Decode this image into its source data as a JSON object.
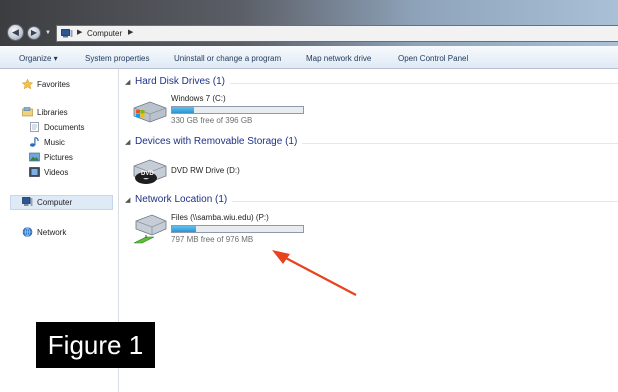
{
  "address_bar": {
    "path": "Computer",
    "icon": "computer-icon"
  },
  "command_bar": {
    "organize": "Organize ▾",
    "system_properties": "System properties",
    "uninstall": "Uninstall or change a program",
    "map_network_drive": "Map network drive",
    "open_control_panel": "Open Control Panel"
  },
  "nav_pane": {
    "favorites": "Favorites",
    "libraries": "Libraries",
    "documents": "Documents",
    "music": "Music",
    "pictures": "Pictures",
    "videos": "Videos",
    "computer": "Computer",
    "network": "Network"
  },
  "groups": {
    "hard_disk": {
      "title": "Hard Disk Drives (1)",
      "drive": {
        "name": "Windows 7 (C:)",
        "free_text": "330 GB free of 396 GB",
        "used_fraction": 0.167,
        "icon": "windows-drive-icon"
      }
    },
    "removable": {
      "title": "Devices with Removable Storage (1)",
      "drive": {
        "name": "DVD RW Drive (D:)",
        "icon": "dvd-drive-icon"
      }
    },
    "network": {
      "title": "Network Location (1)",
      "drive": {
        "name": "Files (\\\\samba.wiu.edu) (P:)",
        "free_text": "797 MB free of 976 MB",
        "used_fraction": 0.183,
        "icon": "network-drive-icon"
      }
    }
  },
  "annotation": {
    "figure_label": "Figure 1",
    "arrow_color": "#e8431d"
  },
  "colors": {
    "header_text": "#1e3287",
    "bar_fill": "#2a94d3",
    "selection": "#dfeaf7"
  }
}
